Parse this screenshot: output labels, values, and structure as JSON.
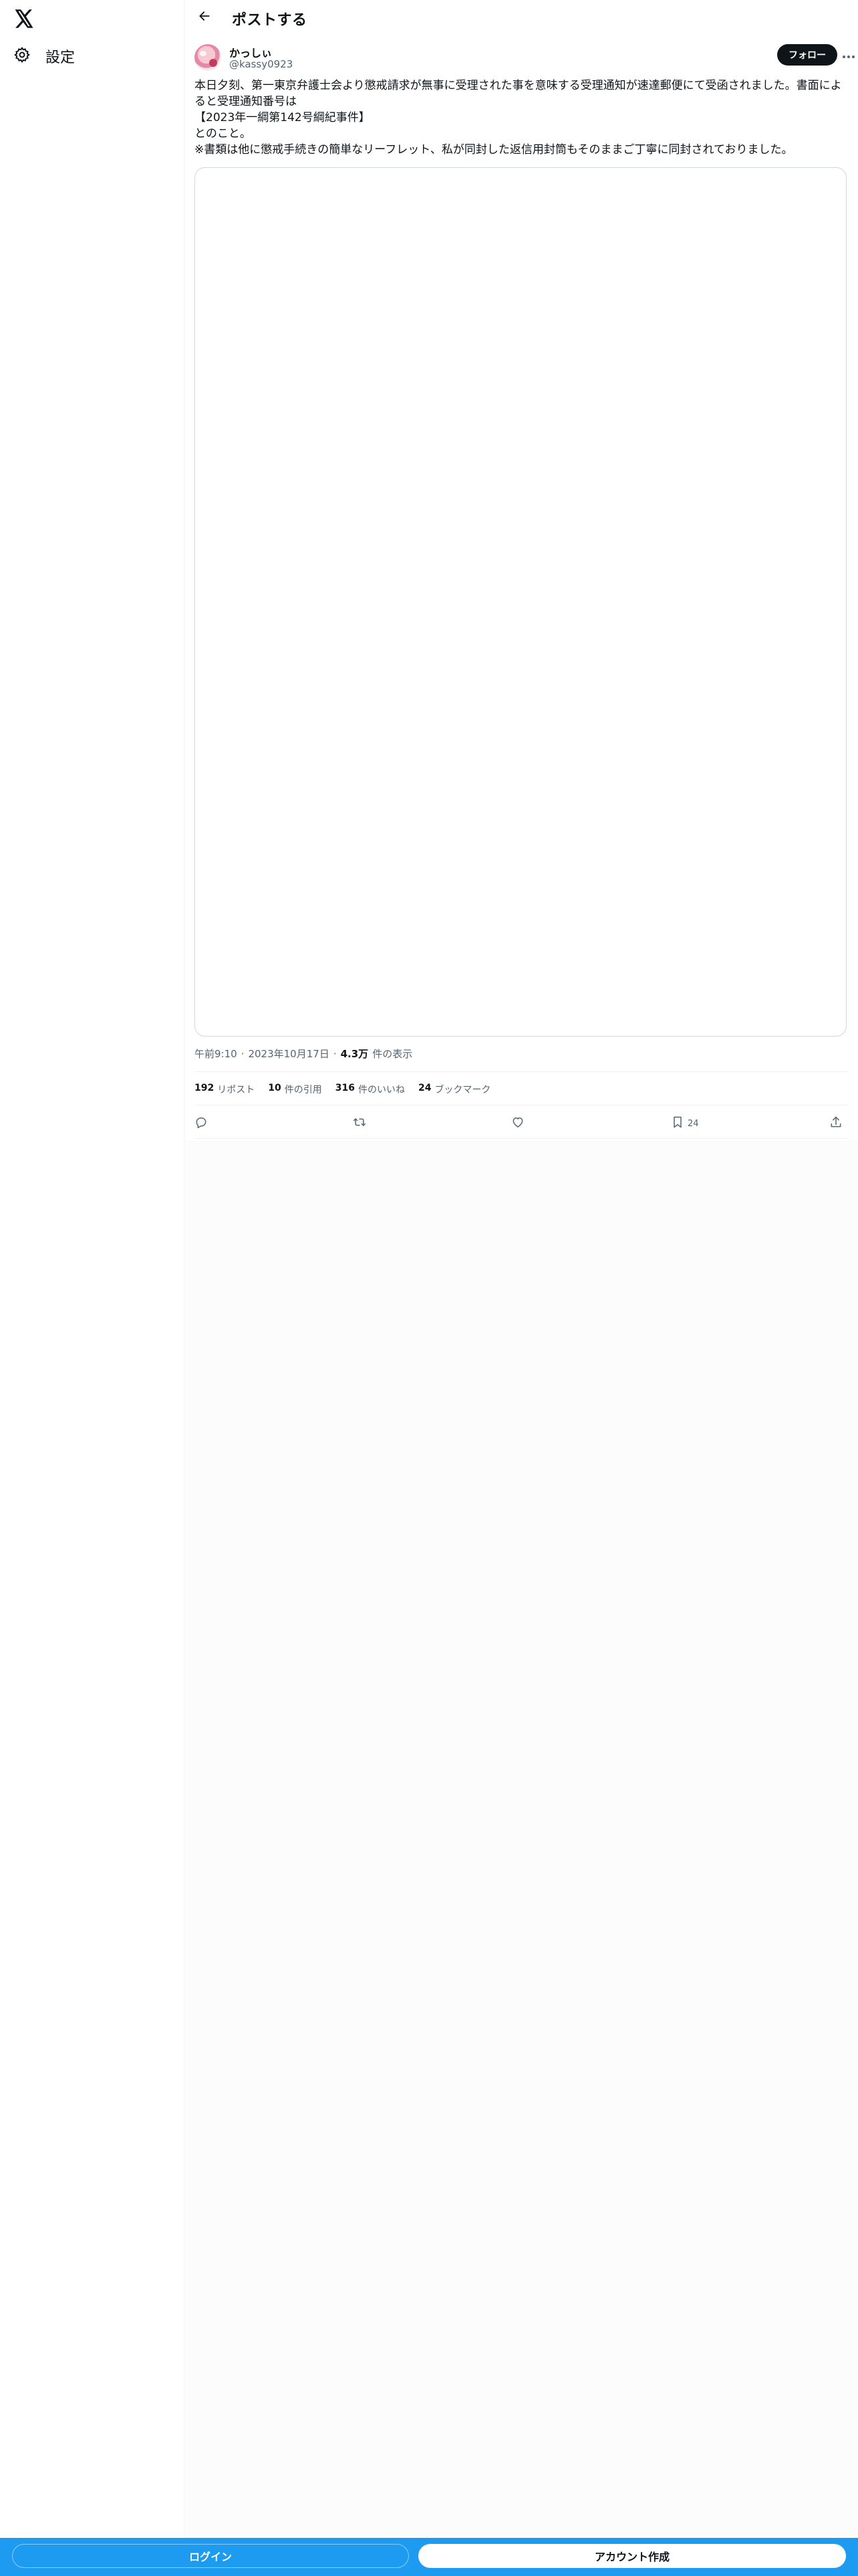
{
  "sidebar": {
    "logo_icon": "x-logo-icon",
    "items": [
      {
        "label": "設定",
        "icon": "gear-icon"
      }
    ]
  },
  "header": {
    "back_icon": "arrow-left-icon",
    "title": "ポストする"
  },
  "post": {
    "author": {
      "name": "かっしぃ",
      "handle": "@kassy0923"
    },
    "follow_label": "フォロー",
    "more_icon": "more-horizontal-icon",
    "text": "本日夕刻、第一東京弁護士会より懲戒請求が無事に受理された事を意味する受理通知が速達郵便にて受函されました。書面によると受理通知番号は\n【2023年一綱第142号綱紀事件】\nとのこと。\n※書類は他に懲戒手続きの簡単なリーフレット、私が同封した返信用封筒もそのままご丁寧に同封されておりました。",
    "time": "午前9:10",
    "date": "2023年10月17日",
    "separator": "·",
    "views_value": "4.3万",
    "views_label": "件の表示",
    "stats": [
      {
        "num": "192",
        "label": "リポスト"
      },
      {
        "num": "10",
        "label": "件の引用"
      },
      {
        "num": "316",
        "label": "件のいいね"
      },
      {
        "num": "24",
        "label": "ブックマーク"
      }
    ],
    "actions": {
      "reply_icon": "reply-icon",
      "repost_icon": "repost-icon",
      "like_icon": "heart-icon",
      "bookmark_icon": "bookmark-icon",
      "bookmark_count": "24",
      "share_icon": "share-icon"
    }
  },
  "bottom_bar": {
    "login_label": "ログイン",
    "signup_label": "アカウント作成",
    "color": "#1d9bf0"
  },
  "colors": {
    "text": "#0f1419",
    "muted": "#536471",
    "border": "#cfd9de",
    "accent": "#1d9bf0"
  }
}
